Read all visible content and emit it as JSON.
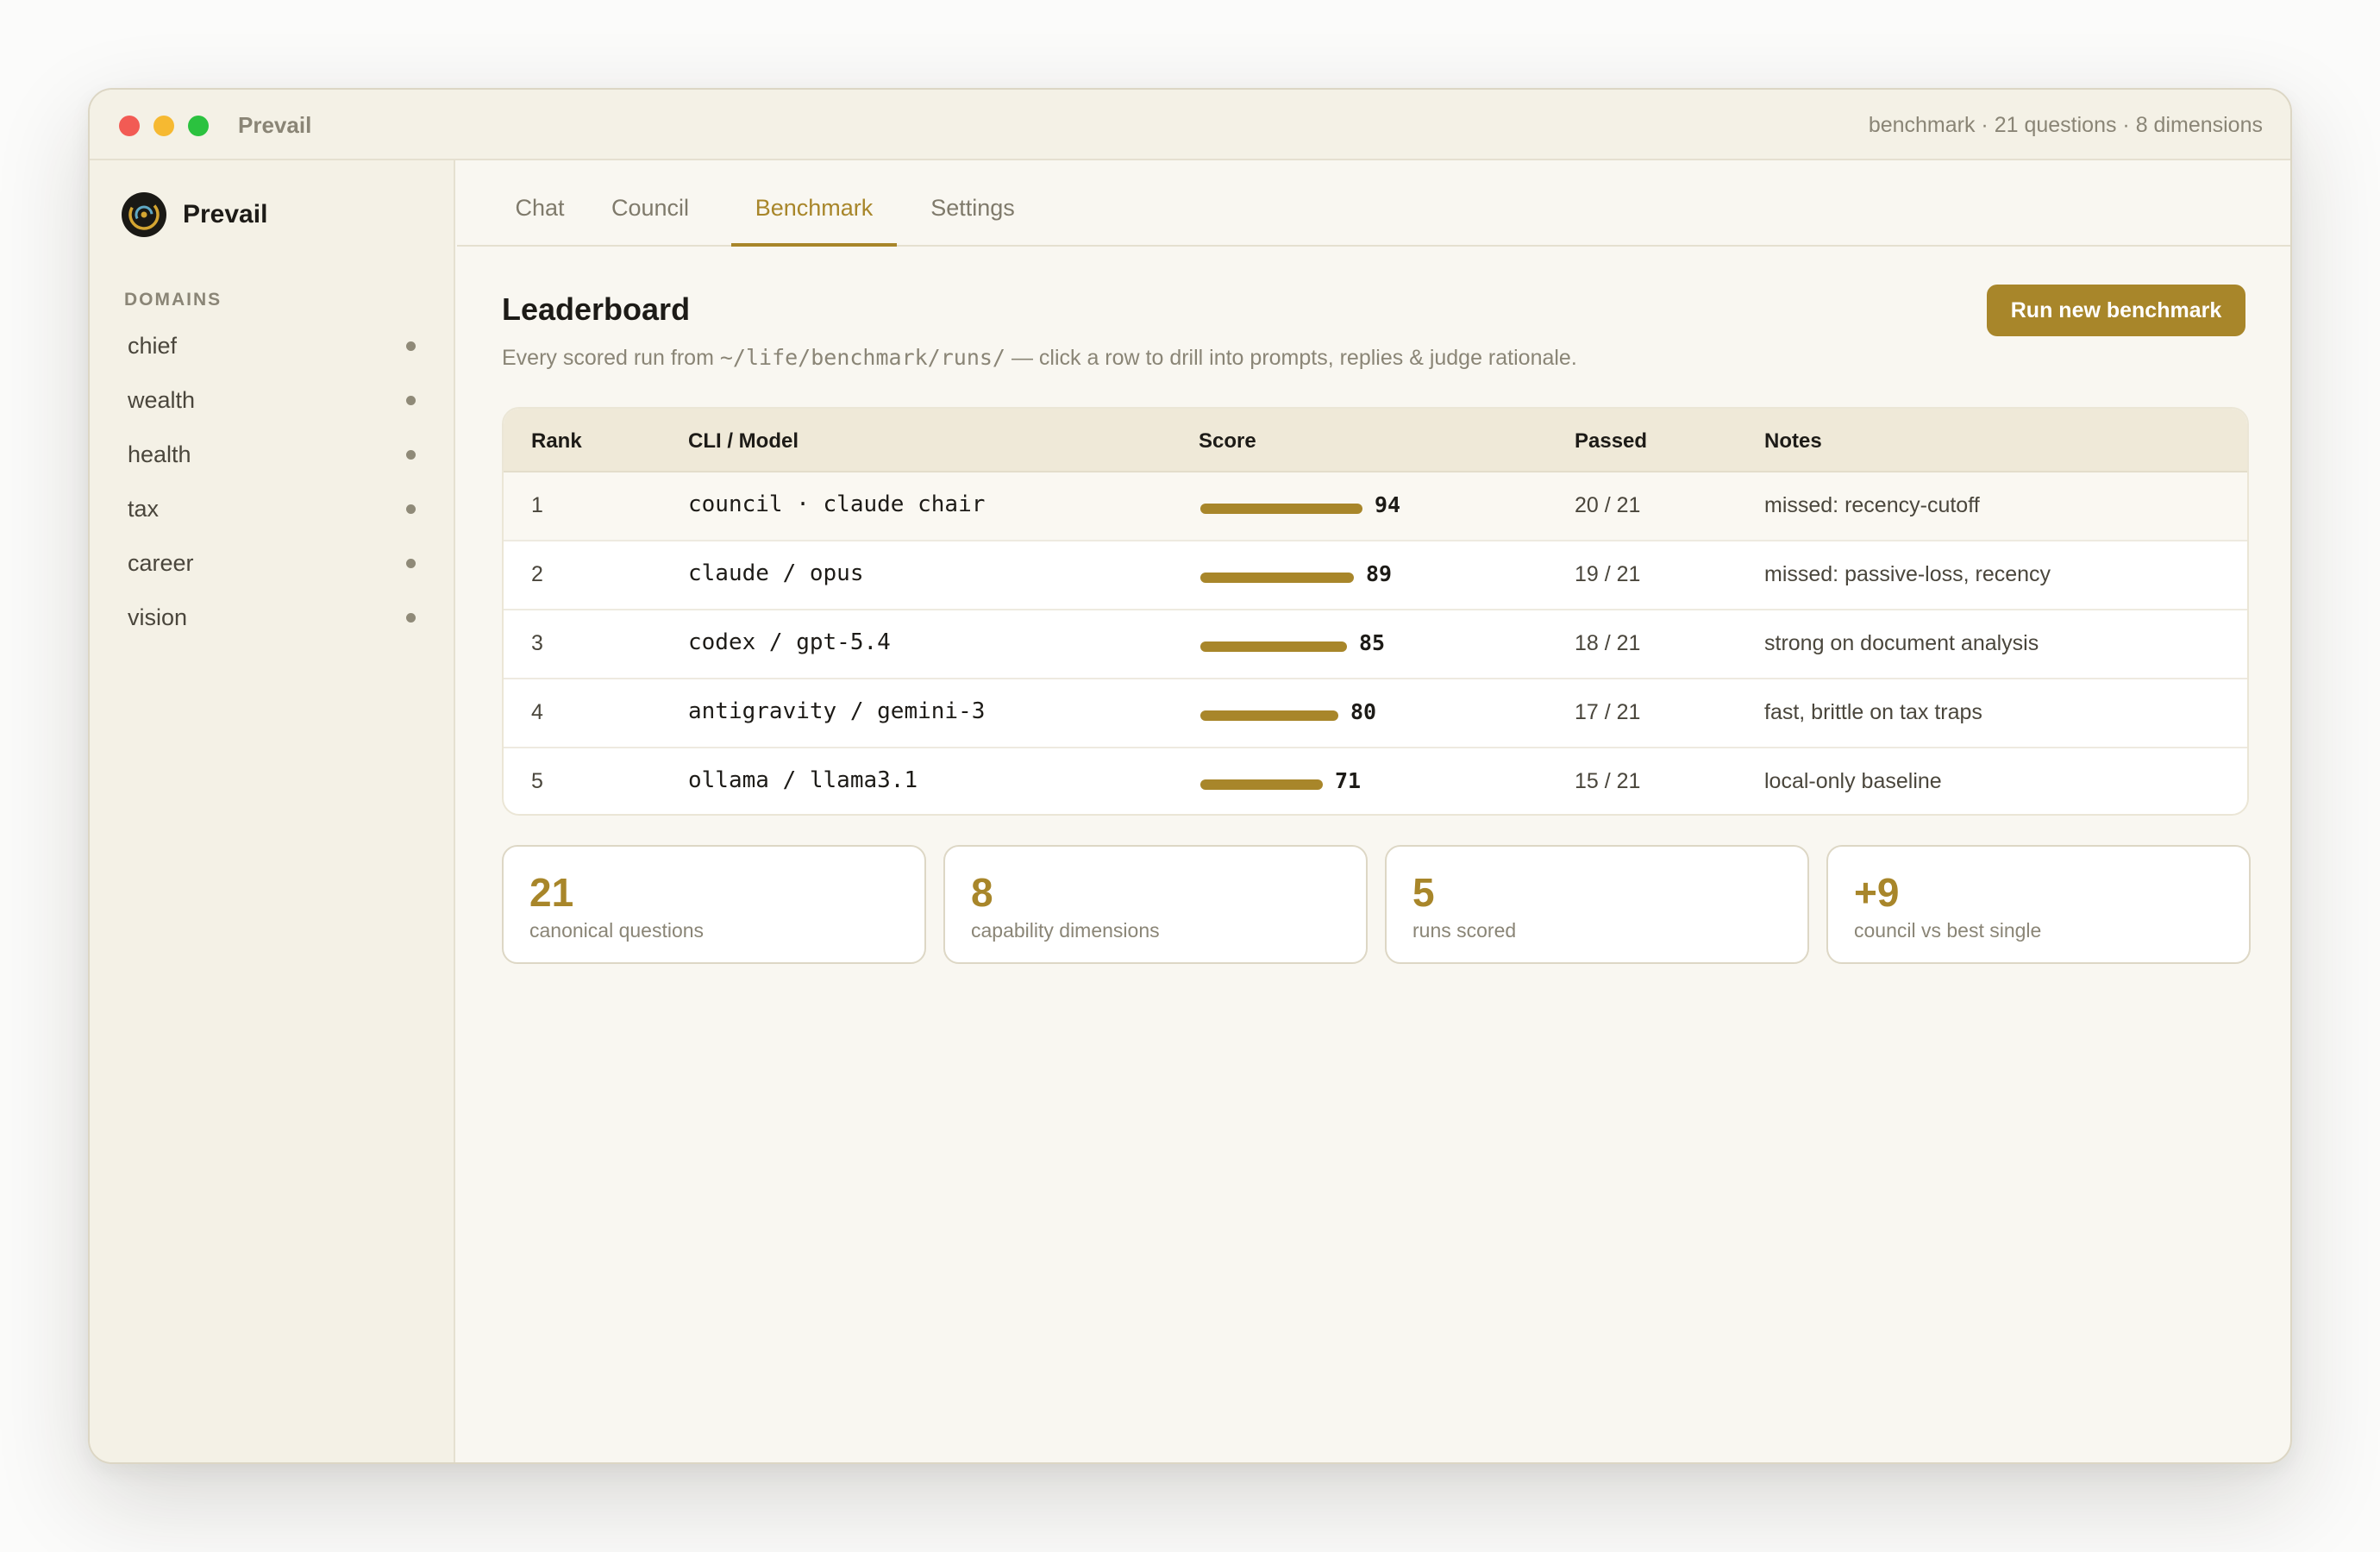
{
  "window": {
    "title": "Prevail",
    "meta": "benchmark · 21 questions · 8 dimensions"
  },
  "sidebar": {
    "brand": "Prevail",
    "section_label": "DOMAINS",
    "items": [
      {
        "label": "chief"
      },
      {
        "label": "wealth"
      },
      {
        "label": "health"
      },
      {
        "label": "tax"
      },
      {
        "label": "career"
      },
      {
        "label": "vision"
      }
    ]
  },
  "tabs": [
    {
      "label": "Chat"
    },
    {
      "label": "Council"
    },
    {
      "label": "Benchmark",
      "active": true
    },
    {
      "label": "Settings"
    }
  ],
  "leaderboard": {
    "title": "Leaderboard",
    "subtitle_pre": "Every scored run from ",
    "subtitle_path": "~/life/benchmark/runs/",
    "subtitle_post": " — click a row to drill into prompts, replies & judge rationale.",
    "run_button": "Run new benchmark",
    "columns": [
      "Rank",
      "CLI / Model",
      "Score",
      "Passed",
      "Notes"
    ],
    "rows": [
      {
        "rank": "1",
        "model": "council · claude chair",
        "score": 94,
        "passed": "20 / 21",
        "notes": "missed: recency-cutoff"
      },
      {
        "rank": "2",
        "model": "claude / opus",
        "score": 89,
        "passed": "19 / 21",
        "notes": "missed: passive-loss, recency"
      },
      {
        "rank": "3",
        "model": "codex / gpt-5.4",
        "score": 85,
        "passed": "18 / 21",
        "notes": "strong on document analysis"
      },
      {
        "rank": "4",
        "model": "antigravity / gemini-3",
        "score": 80,
        "passed": "17 / 21",
        "notes": "fast, brittle on tax traps"
      },
      {
        "rank": "5",
        "model": "ollama / llama3.1",
        "score": 71,
        "passed": "15 / 21",
        "notes": "local-only baseline"
      }
    ]
  },
  "stats": [
    {
      "value": "21",
      "label": "canonical questions"
    },
    {
      "value": "8",
      "label": "capability dimensions"
    },
    {
      "value": "5",
      "label": "runs scored"
    },
    {
      "value": "+9",
      "label": "council vs best single"
    }
  ],
  "colors": {
    "accent": "#a8862a",
    "sidebar_bg": "#f4f1e6",
    "main_bg": "#f9f7f1",
    "table_header_bg": "#efe9d8"
  }
}
